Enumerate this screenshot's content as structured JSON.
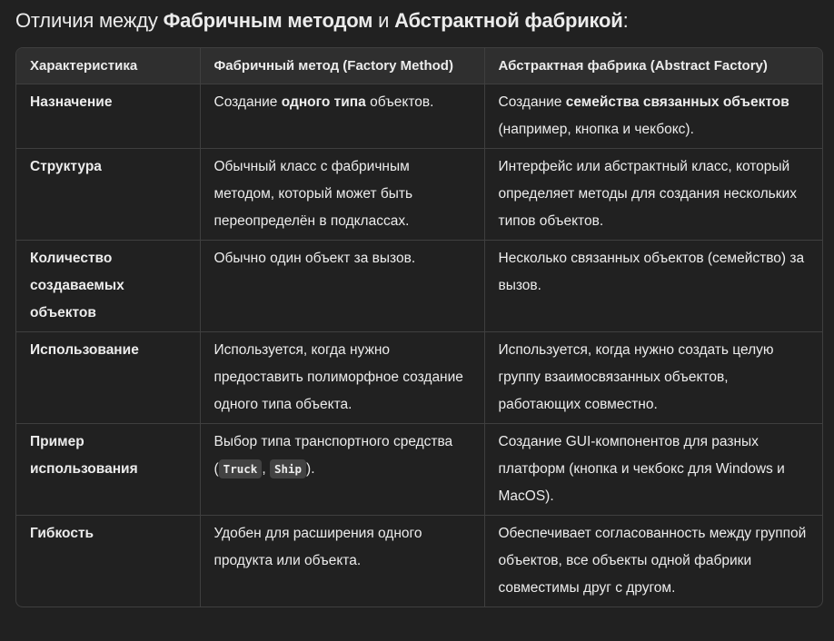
{
  "title": [
    {
      "t": "Отличия между "
    },
    {
      "t": "Фабричным методом",
      "b": true
    },
    {
      "t": " и "
    },
    {
      "t": "Абстрактной фабрикой",
      "b": true
    },
    {
      "t": ":"
    }
  ],
  "headers": [
    "Характеристика",
    "Фабричный метод (Factory Method)",
    "Абстрактная фабрика (Abstract Factory)"
  ],
  "rows": [
    [
      [
        {
          "t": "Назначение"
        }
      ],
      [
        {
          "t": "Создание "
        },
        {
          "t": "одного типа",
          "b": true
        },
        {
          "t": " объектов."
        }
      ],
      [
        {
          "t": "Создание "
        },
        {
          "t": "семейства связанных объектов",
          "b": true
        },
        {
          "t": " (например, кнопка и чекбокс)."
        }
      ]
    ],
    [
      [
        {
          "t": "Структура"
        }
      ],
      [
        {
          "t": "Обычный класс с фабричным методом, который может быть переопределён в подклассах."
        }
      ],
      [
        {
          "t": "Интерфейс или абстрактный класс, который определяет методы для создания нескольких типов объектов."
        }
      ]
    ],
    [
      [
        {
          "t": "Количество создаваемых объектов"
        }
      ],
      [
        {
          "t": "Обычно один объект за вызов."
        }
      ],
      [
        {
          "t": "Несколько связанных объектов (семейство) за вызов."
        }
      ]
    ],
    [
      [
        {
          "t": "Использование"
        }
      ],
      [
        {
          "t": "Используется, когда нужно предоставить полиморфное создание одного типа объекта."
        }
      ],
      [
        {
          "t": "Используется, когда нужно создать целую группу взаимосвязанных объектов, работающих совместно."
        }
      ]
    ],
    [
      [
        {
          "t": "Пример использования"
        }
      ],
      [
        {
          "t": "Выбор типа транспортного средства ("
        },
        {
          "t": "Truck",
          "code": true
        },
        {
          "t": ", "
        },
        {
          "t": "Ship",
          "code": true
        },
        {
          "t": ")."
        }
      ],
      [
        {
          "t": "Создание GUI-компонентов для разных платформ (кнопка и чекбокс для Windows и MacOS)."
        }
      ]
    ],
    [
      [
        {
          "t": "Гибкость"
        }
      ],
      [
        {
          "t": "Удобен для расширения одного продукта или объекта."
        }
      ],
      [
        {
          "t": "Обеспечивает согласованность между группой объектов, все объекты одной фабрики совместимы друг с другом."
        }
      ]
    ]
  ]
}
